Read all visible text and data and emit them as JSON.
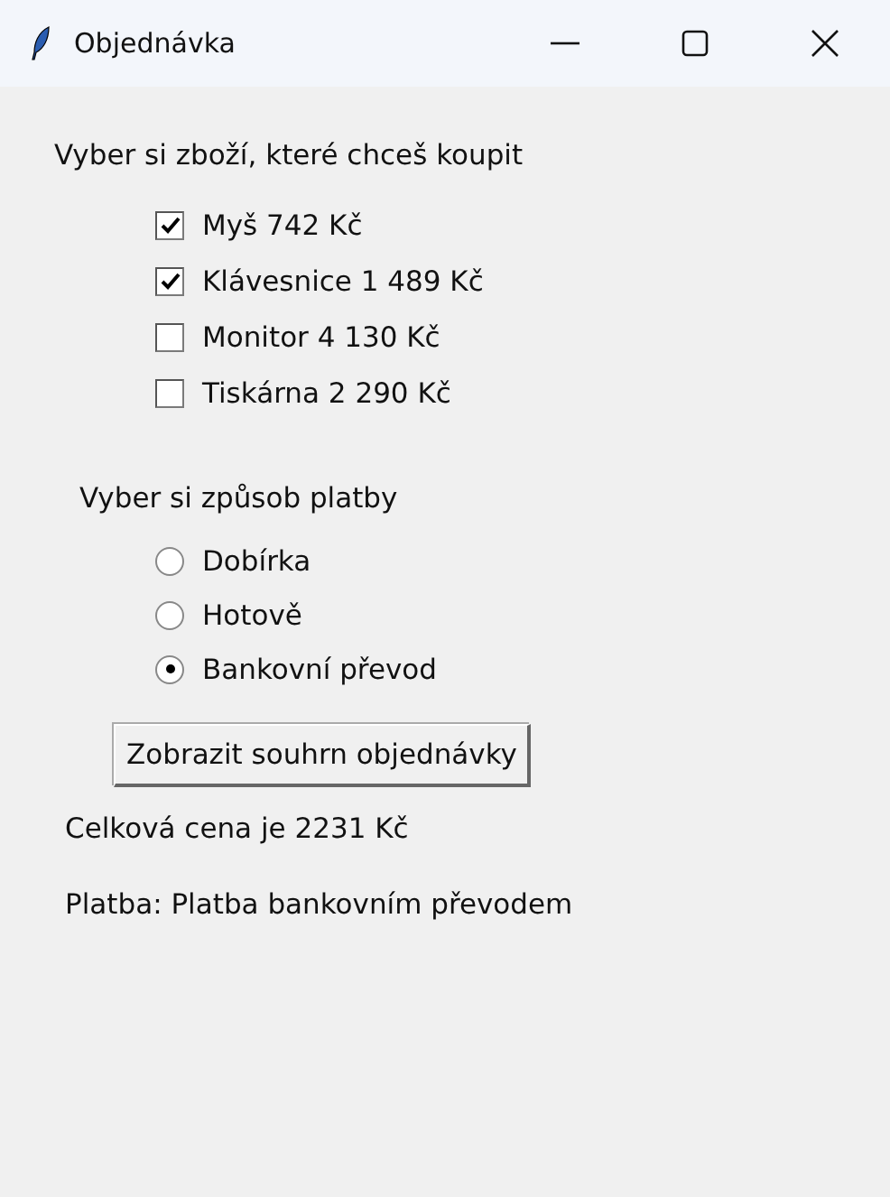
{
  "window": {
    "title": "Objednávka"
  },
  "products_heading": "Vyber si zboží, které chceš koupit",
  "products": [
    {
      "label": "Myš 742 Kč",
      "checked": true
    },
    {
      "label": "Klávesnice 1 489 Kč",
      "checked": true
    },
    {
      "label": "Monitor 4 130 Kč",
      "checked": false
    },
    {
      "label": "Tiskárna 2 290 Kč",
      "checked": false
    }
  ],
  "payment_heading": "Vyber si způsob platby",
  "payments": [
    {
      "label": "Dobírka",
      "selected": false
    },
    {
      "label": "Hotově",
      "selected": false
    },
    {
      "label": "Bankovní převod",
      "selected": true
    }
  ],
  "button": "Zobrazit souhrn objednávky",
  "total": "Celková cena je 2231 Kč",
  "payment_result": "Platba: Platba bankovním převodem"
}
